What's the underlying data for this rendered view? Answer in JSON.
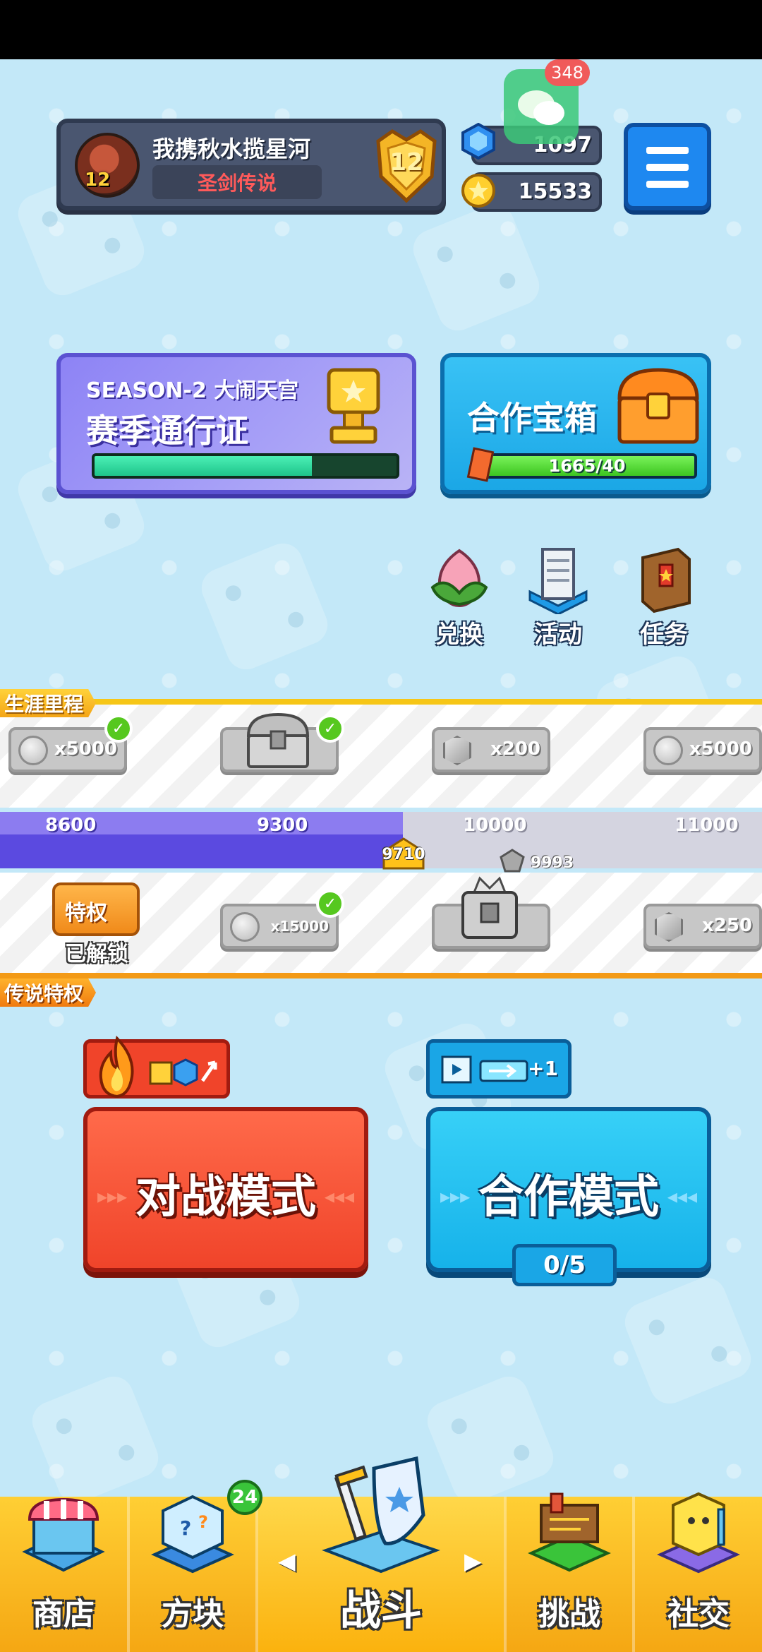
{
  "profile": {
    "level": "12",
    "name": "我携秋水揽星河",
    "title": "圣剑传说",
    "rank": "12"
  },
  "notifications": {
    "wechat_badge": "348"
  },
  "currencies": {
    "gems": "1097",
    "coins": "15533"
  },
  "season_pass": {
    "subtitle": "SEASON-2 大闹天宫",
    "title": "赛季通行证",
    "progress": 0.72
  },
  "coop_chest": {
    "title": "合作宝箱",
    "progress_text": "1665/40",
    "progress": 1.0
  },
  "quick_actions": [
    {
      "label": "兑换",
      "icon": "peach-icon"
    },
    {
      "label": "活动",
      "icon": "activity-tower-icon"
    },
    {
      "label": "任务",
      "icon": "quest-book-icon"
    }
  ],
  "career": {
    "tag": "生涯里程",
    "top_rewards": [
      {
        "label": "x5000",
        "icon": "silver-star-coin-icon",
        "claimed": true
      },
      {
        "label": "",
        "icon": "silver-chest-icon",
        "claimed": true
      },
      {
        "label": "x200",
        "icon": "silver-cube-icon",
        "claimed": false
      },
      {
        "label": "x5000",
        "icon": "silver-star-coin-icon",
        "claimed": false
      }
    ],
    "ticks": [
      "8600",
      "9300",
      "10000",
      "11000"
    ],
    "current": "9710",
    "friend_score": "9993",
    "progress_value": 9710,
    "bottom_rewards": [
      {
        "label": "x15000",
        "icon": "silver-star-coin-icon",
        "claimed": true
      },
      {
        "label": "",
        "icon": "silver-crown-chest-icon",
        "claimed": false
      },
      {
        "label": "x250",
        "icon": "silver-cube-icon",
        "claimed": false
      }
    ],
    "privilege": {
      "badge": "特权",
      "status": "已解锁"
    },
    "legend_tag": "传说特权"
  },
  "modes": {
    "pvp_label": "对战模式",
    "coop_label": "合作模式",
    "coop_count": "0/5",
    "ad_bonus": "+1"
  },
  "nav": {
    "items": [
      {
        "label": "商店",
        "icon": "shop-stall-icon"
      },
      {
        "label": "方块",
        "icon": "mystery-block-icon"
      },
      {
        "label": "战斗",
        "icon": "sword-shield-icon"
      },
      {
        "label": "挑战",
        "icon": "challenge-sign-icon"
      },
      {
        "label": "社交",
        "icon": "social-character-icon"
      }
    ],
    "blocks_badge": "24"
  },
  "colors": {
    "pvp": "#f0442a",
    "coop": "#16b2ea",
    "nav": "#ffcf34",
    "season": "#8d83f5"
  }
}
